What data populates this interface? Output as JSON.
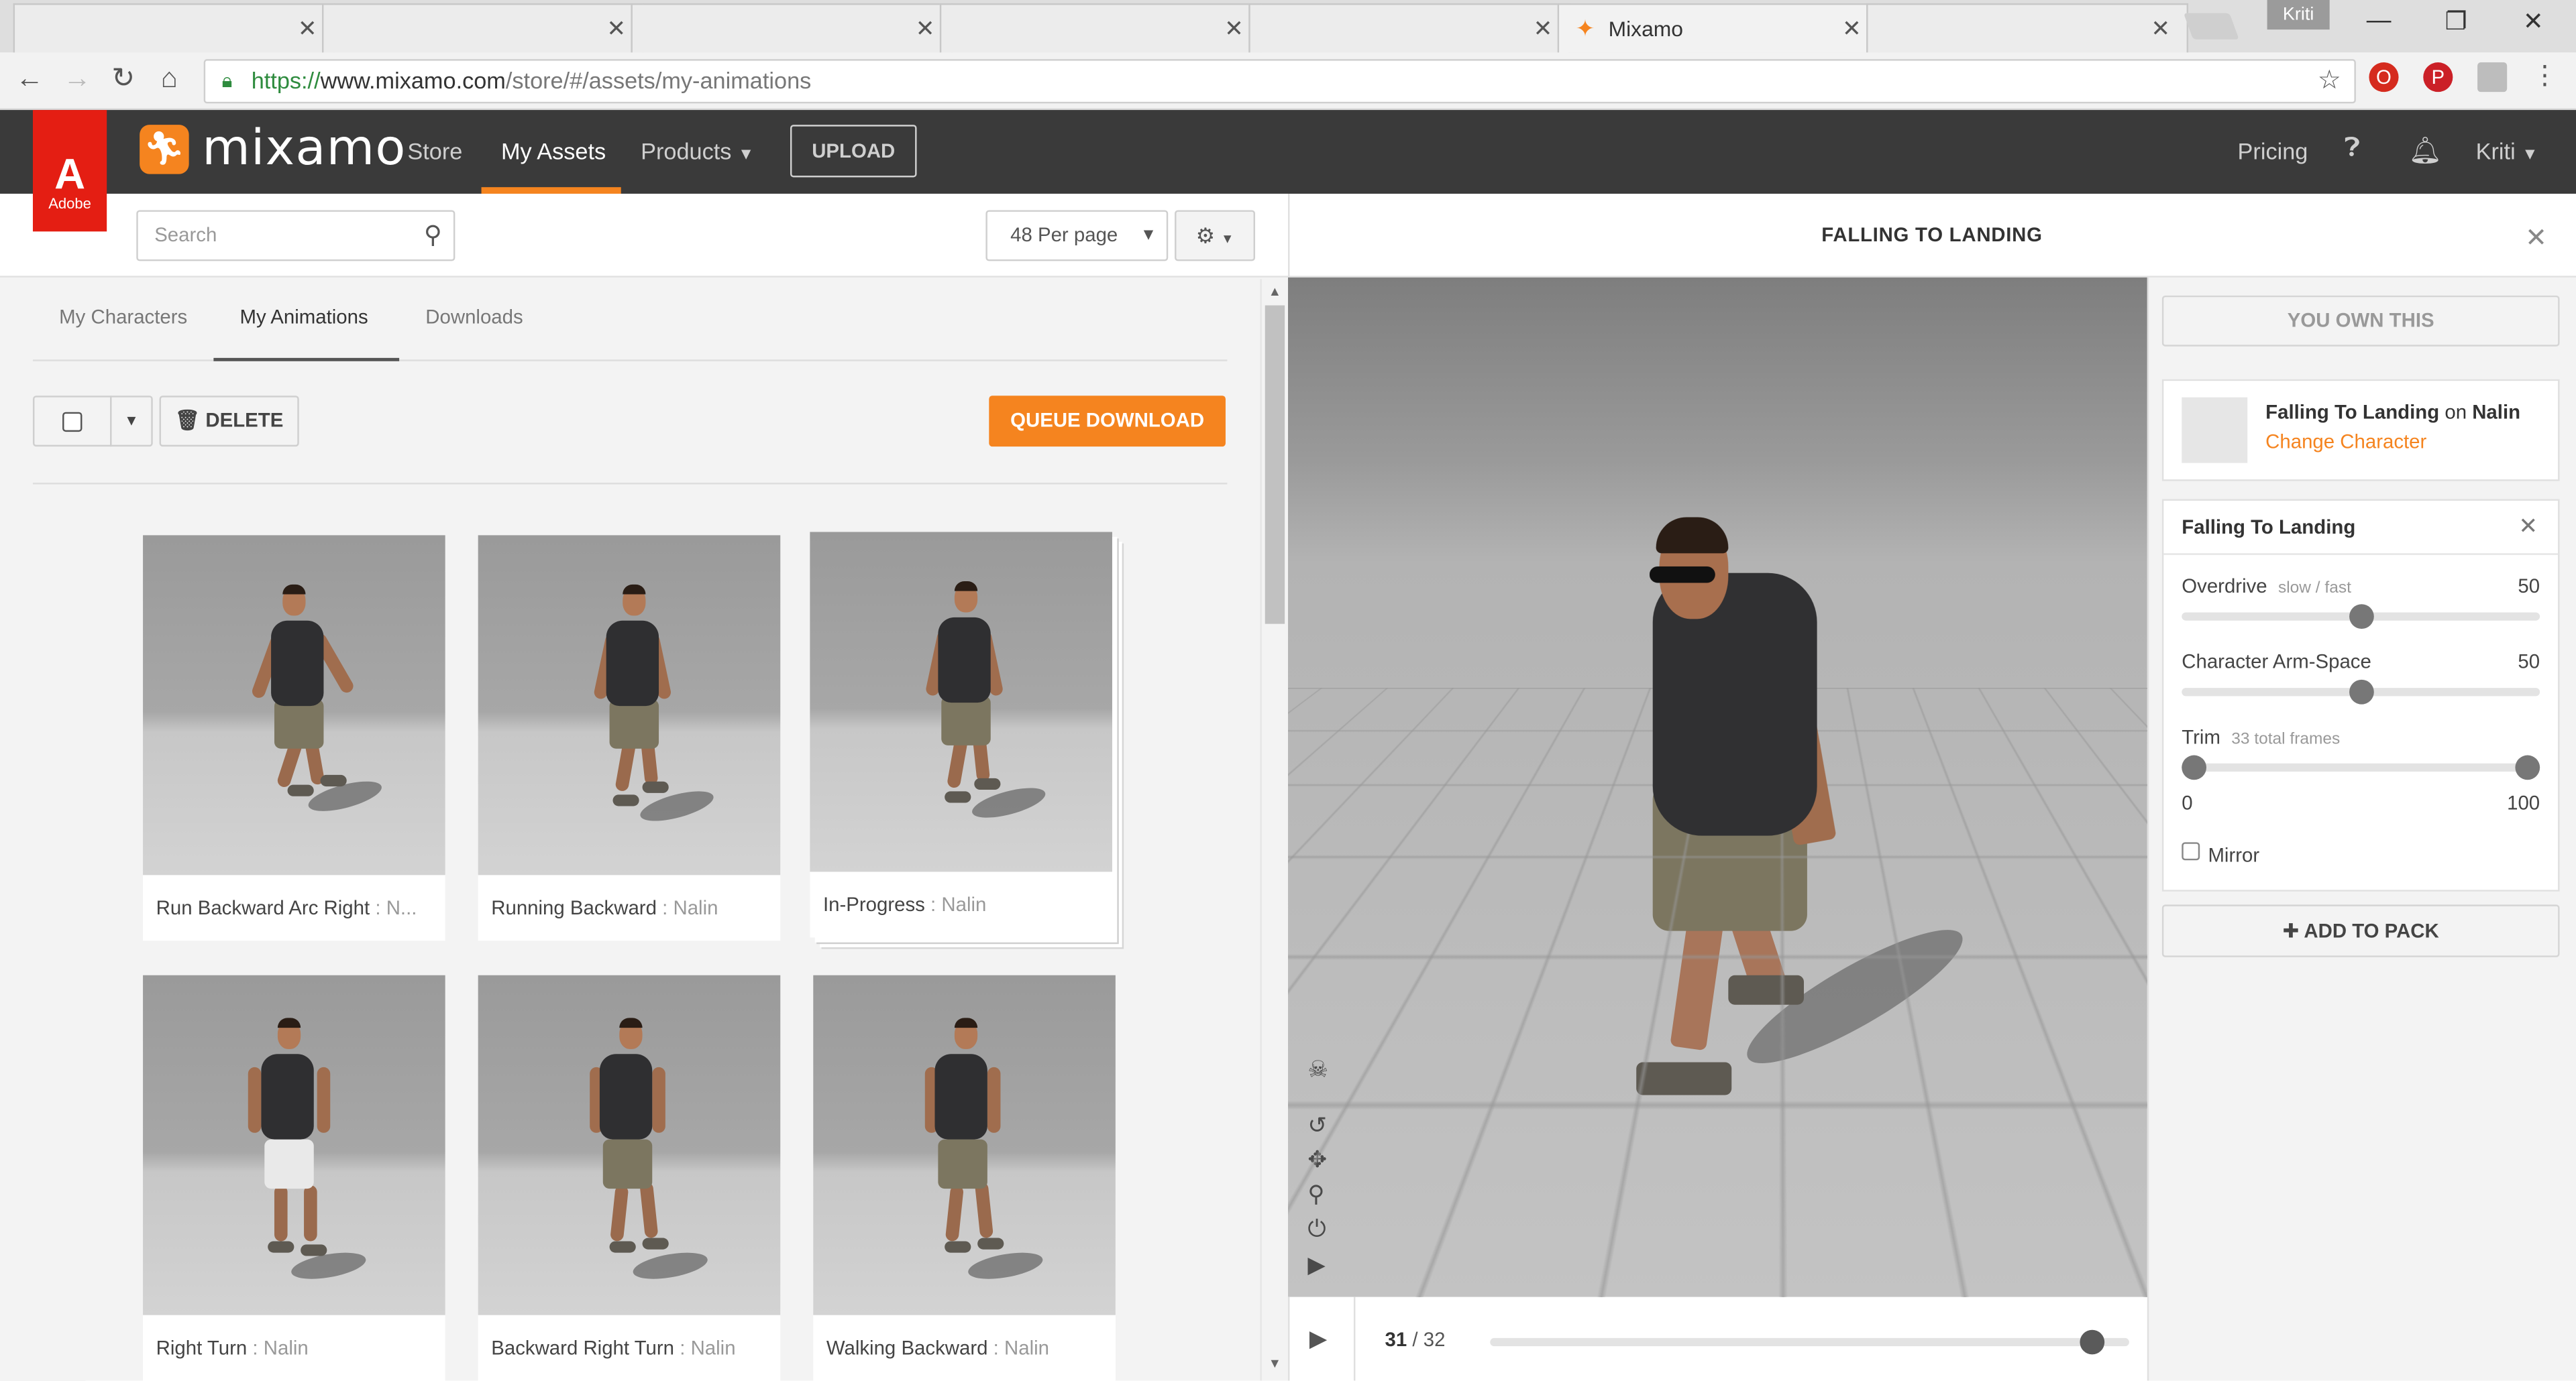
{
  "browser": {
    "tabs": [
      {
        "label": ""
      },
      {
        "label": ""
      },
      {
        "label": ""
      },
      {
        "label": ""
      },
      {
        "label": ""
      },
      {
        "label": "Mixamo",
        "active": true
      },
      {
        "label": ""
      }
    ],
    "profile_name": "Kriti",
    "url_https": "https://",
    "url_host": "www.mixamo.com",
    "url_path": "/store/#/assets/my-animations"
  },
  "navbar": {
    "adobe_label": "Adobe",
    "brand": "mixamo",
    "links": {
      "store": "Store",
      "my_assets": "My Assets",
      "products": "Products"
    },
    "upload_label": "UPLOAD",
    "pricing_label": "Pricing",
    "user_label": "Kriti"
  },
  "toolbar": {
    "search_placeholder": "Search",
    "per_page": "48 Per page"
  },
  "asset_tabs": {
    "characters": "My Characters",
    "animations": "My Animations",
    "downloads": "Downloads"
  },
  "actions": {
    "delete_label": "DELETE",
    "queue_download_label": "QUEUE DOWNLOAD"
  },
  "cards": [
    {
      "title": "Run Backward Arc Right",
      "sep": " : ",
      "character": "N..."
    },
    {
      "title": "Running Backward",
      "sep": " : ",
      "character": "Nalin"
    },
    {
      "title": "In-Progress",
      "sep": " : ",
      "character": "Nalin"
    },
    {
      "title": "Right Turn",
      "sep": " : ",
      "character": "Nalin"
    },
    {
      "title": "Backward Right Turn",
      "sep": " : ",
      "character": "Nalin"
    },
    {
      "title": "Walking Backward",
      "sep": " : ",
      "character": "Nalin"
    }
  ],
  "viewer": {
    "title": "FALLING TO LANDING",
    "current_frame": "31",
    "frame_sep": " / ",
    "total_frames": "32",
    "progress": 0.96
  },
  "sidebar": {
    "own_label": "YOU OWN THIS",
    "anim_name": "Falling To Landing",
    "on_word": " on ",
    "char_name": "Nalin",
    "change_character": "Change Character",
    "settings_title": "Falling To Landing",
    "overdrive": {
      "label": "Overdrive",
      "hint": "slow / fast",
      "value": "50",
      "level": 0.5
    },
    "arm_space": {
      "label": "Character Arm-Space",
      "value": "50",
      "level": 0.5
    },
    "trim": {
      "label": "Trim",
      "hint": "33 total frames",
      "min": "0",
      "max": "100",
      "start": 0.0,
      "end": 1.0
    },
    "mirror_label": "Mirror",
    "add_to_pack": "ADD TO PACK"
  },
  "colors": {
    "accent": "#f5841f",
    "navbar": "#3a3a3a",
    "adobe_red": "#e41e13"
  }
}
